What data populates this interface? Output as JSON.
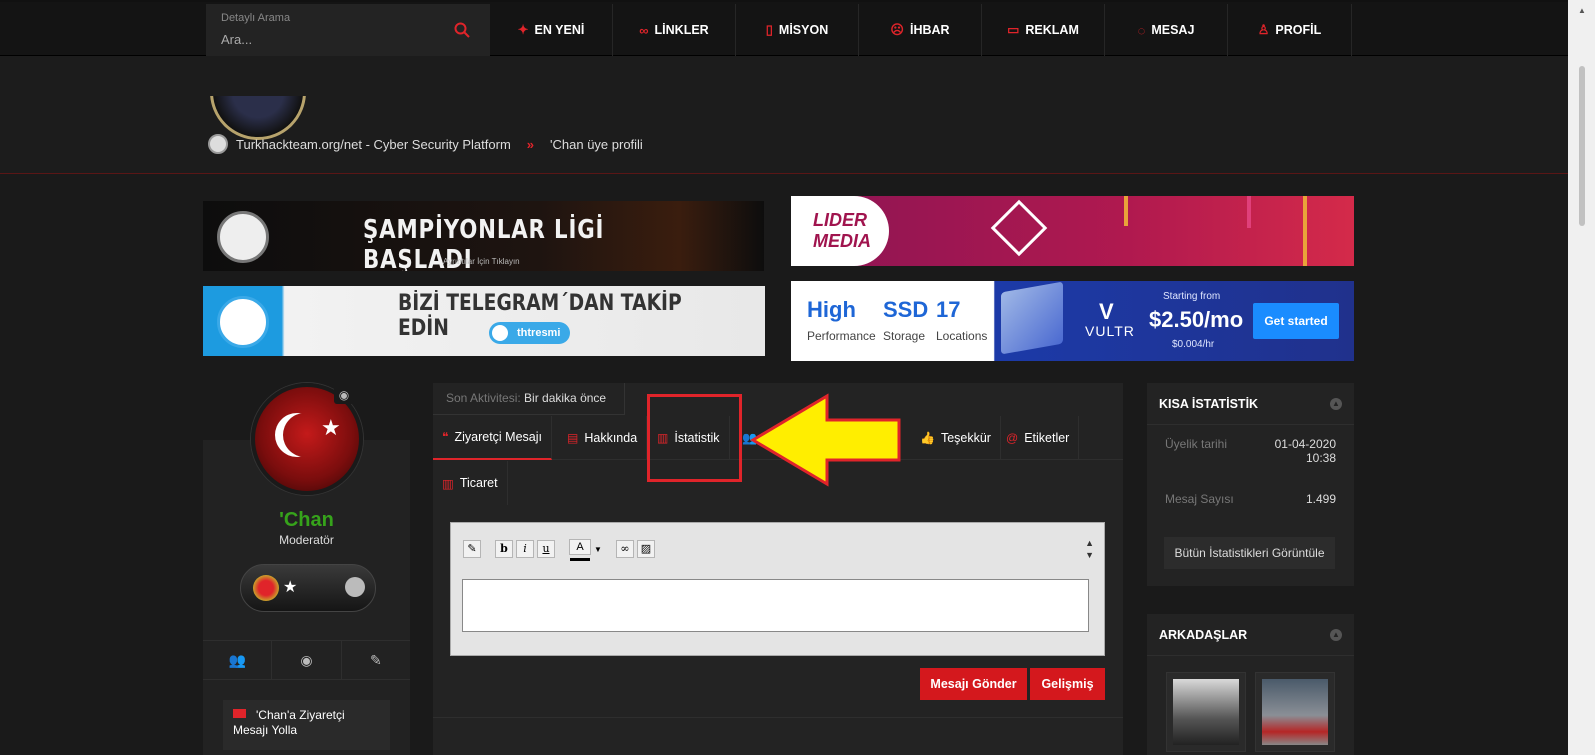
{
  "search": {
    "label": "Detaylı Arama",
    "placeholder": "Ara..."
  },
  "nav": [
    {
      "label": "EN YENİ",
      "icon": "pin-icon",
      "glyph": "📌"
    },
    {
      "label": "LİNKLER",
      "icon": "link-icon",
      "glyph": "🔗"
    },
    {
      "label": "MİSYON",
      "icon": "bookmark-icon",
      "glyph": "🔖"
    },
    {
      "label": "İHBAR",
      "icon": "alert-face-icon",
      "glyph": "☹"
    },
    {
      "label": "REKLAM",
      "icon": "monitor-icon",
      "glyph": "▭"
    },
    {
      "label": "MESAJ",
      "icon": "chat-icon",
      "glyph": "💬"
    },
    {
      "label": "PROFİL",
      "icon": "user-icon",
      "glyph": "👤"
    }
  ],
  "breadcrumb": {
    "home": "Turkhackteam.org/net - Cyber Security Platform",
    "separator": "»",
    "current": "'Chan üye profili"
  },
  "banners": {
    "champions": {
      "title": "ŞAMPİYONLAR LİGİ BAŞLADI",
      "subtitle": "Ayrıntılar İçin Tıklayın"
    },
    "lider": {
      "line1": "LIDER",
      "line2": "MEDIA"
    },
    "telegram": {
      "title": "BİZİ TELEGRAM´DAN TAKİP EDİN",
      "handle": "thtresmi"
    },
    "vultr": {
      "f1_big": "High",
      "f1_small": "Performance",
      "f2_big": "SSD",
      "f2_small": "Storage",
      "f3_big": "17",
      "f3_small": "Locations",
      "brand": "VULTR",
      "starting": "Starting from",
      "price": "$2.50/mo",
      "hourly": "$0.004/hr",
      "cta": "Get started"
    }
  },
  "profile": {
    "name": "'Chan",
    "role": "Moderatör",
    "visitor_link": "'Chan'a Ziyaretçi Mesajı Yolla"
  },
  "activity": {
    "label": "Son Aktivitesi:",
    "value": "Bir dakika önce"
  },
  "tabs": [
    {
      "label": "Ziyaretçi Mesajı",
      "icon": "comments-icon"
    },
    {
      "label": "Hakkında",
      "icon": "id-card-icon"
    },
    {
      "label": "İstatistik",
      "icon": "bar-chart-icon"
    },
    {
      "label": "Teşekkür",
      "icon": "thumbs-up-icon"
    },
    {
      "label": "Etiketler",
      "icon": "at-icon"
    },
    {
      "label": "Ticaret",
      "icon": "bar-chart-icon"
    }
  ],
  "editor": {
    "bold": "b",
    "italic": "i",
    "underline": "u",
    "color": "A"
  },
  "buttons": {
    "send": "Mesajı Gönder",
    "advanced": "Gelişmiş"
  },
  "stats": {
    "title": "KISA İSTATİSTİK",
    "joined_label": "Üyelik tarihi",
    "joined_date": "01-04-2020",
    "joined_time": "10:38",
    "posts_label": "Mesaj Sayısı",
    "posts_value": "1.499",
    "all_button": "Bütün İstatistikleri Görüntüle"
  },
  "friends": {
    "title": "ARKADAŞLAR"
  },
  "colors": {
    "accent": "#e0242a",
    "username": "#36a31b",
    "highlight": "#ffee00"
  }
}
